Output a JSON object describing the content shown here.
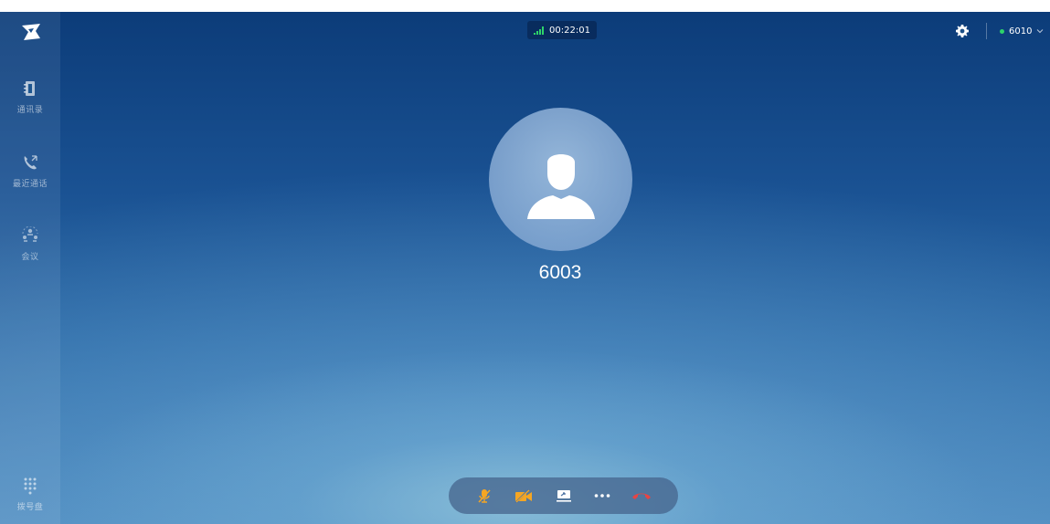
{
  "sidebar": {
    "items": [
      {
        "label": "通讯录",
        "icon": "contacts-icon"
      },
      {
        "label": "最近通话",
        "icon": "recent-calls-icon"
      },
      {
        "label": "会议",
        "icon": "meeting-icon"
      }
    ],
    "dialpad": {
      "label": "拨号盘",
      "icon": "dialpad-icon"
    }
  },
  "header": {
    "call_timer": "00:22:01",
    "account": "6010",
    "account_status_color": "#2ed36a",
    "settings_icon": "gear-icon"
  },
  "call": {
    "remote_number": "6003"
  },
  "controls": [
    {
      "name": "mute",
      "icon": "microphone-muted-icon",
      "color": "#f5a623"
    },
    {
      "name": "video",
      "icon": "camera-off-icon",
      "color": "#f5a623"
    },
    {
      "name": "share",
      "icon": "screen-share-icon",
      "color": "#ffffff"
    },
    {
      "name": "more",
      "icon": "more-icon",
      "color": "#ffffff"
    },
    {
      "name": "hangup",
      "icon": "hang-up-icon",
      "color": "#e64545"
    }
  ]
}
